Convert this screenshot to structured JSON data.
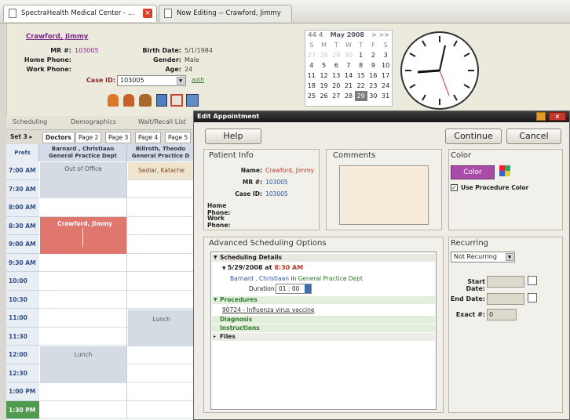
{
  "browser_tabs": [
    {
      "label": "SpectraHealth Medical Center - ..."
    },
    {
      "label": "Now Editing -- Crawford, Jimmy"
    }
  ],
  "patient": {
    "name": "Crawford, Jimmy",
    "mr_label": "MR #:",
    "mr": "103005",
    "home_phone_label": "Home Phone:",
    "work_phone_label": "Work Phone:",
    "birth_label": "Birth Date:",
    "birth": "5/1/1984",
    "gender_label": "Gender:",
    "gender": "Male",
    "age_label": "Age:",
    "age": "24",
    "case_label": "Case ID:",
    "case": "103005",
    "auth": "auth"
  },
  "minical": {
    "nav": "44 4",
    "title": "May 2008",
    "nav_next": "> >>",
    "dow": [
      "S",
      "M",
      "T",
      "W",
      "T",
      "F",
      "S"
    ],
    "weeks": [
      [
        "27",
        "28",
        "29",
        "30",
        "1",
        "2",
        "3"
      ],
      [
        "4",
        "5",
        "6",
        "7",
        "8",
        "9",
        "10"
      ],
      [
        "11",
        "12",
        "13",
        "14",
        "15",
        "16",
        "17"
      ],
      [
        "18",
        "19",
        "20",
        "21",
        "22",
        "23",
        "24"
      ],
      [
        "25",
        "26",
        "27",
        "28",
        "29",
        "30",
        "31"
      ]
    ],
    "selected": "29"
  },
  "tabs": [
    "Scheduling",
    "Demographics",
    "Wait/Recall List"
  ],
  "grid_tabs": {
    "set": "Set 3",
    "doctors": "Doctors",
    "pages": [
      "Page 2",
      "Page 3",
      "Page 4",
      "Page 5"
    ]
  },
  "grid": {
    "corner": "Prefs",
    "columns": [
      {
        "name": "Barnard , Christiaan",
        "dept": "General Practice Dept"
      },
      {
        "name": "Billroth, Theodo",
        "dept": "General Practice D"
      }
    ],
    "times": [
      "7:00 AM",
      "7:30 AM",
      "8:00 AM",
      "8:30 AM",
      "9:00 AM",
      "9:30 AM",
      "10:00 AM",
      "10:30 AM",
      "11:00 AM",
      "11:30 AM",
      "12:00 PM",
      "12:30 PM",
      "1:00 PM",
      "1:30 PM"
    ],
    "blocks": {
      "out_of_office": "Out of Office",
      "appointment": "Crawford, Jimmy",
      "lunch": "Lunch",
      "lunch2": "Lunch",
      "sedlar": "Sedlar, Katache"
    }
  },
  "dialog": {
    "title": "Edit Appointment",
    "help": "Help",
    "continue": "Continue",
    "cancel": "Cancel",
    "patient_info": {
      "title": "Patient Info",
      "name_label": "Name:",
      "name": "Crawford, Jimmy",
      "mr_label": "MR #:",
      "mr": "103005",
      "case_label": "Case ID:",
      "case": "103005",
      "home_label": "Home Phone:",
      "work_label": "Work Phone:"
    },
    "comments_title": "Comments",
    "color": {
      "title": "Color",
      "button": "Color",
      "use_procedure": "Use Procedure Color",
      "checked": true
    },
    "advanced": {
      "title": "Advanced Scheduling Options",
      "details_header": "Scheduling Details",
      "date": "5/29/2008",
      "at": " at ",
      "time": "8:30 AM",
      "provider": "Barnard , Christiaan",
      "in": " in ",
      "dept": "General Practice Dept",
      "duration_label": "Duration:",
      "duration": "01 : 00",
      "procedures": "Procedures",
      "procedure_item": "90724 - Influenza virus vaccine",
      "diagnosis": "Diagnosis",
      "instructions": "Instructions",
      "files": "Files"
    },
    "recurring": {
      "title": "Recurring",
      "select": "Not Recurring",
      "start_label": "Start Date:",
      "end_label": "End Date:",
      "exact_label": "Exact #:",
      "exact_value": "0"
    }
  },
  "colors": {
    "appointment": "#e0776e",
    "title_bar": "#1c1c1c",
    "color_button": "#a94ca9",
    "link_blue": "#2a53a0",
    "red_text": "#c0392b"
  }
}
